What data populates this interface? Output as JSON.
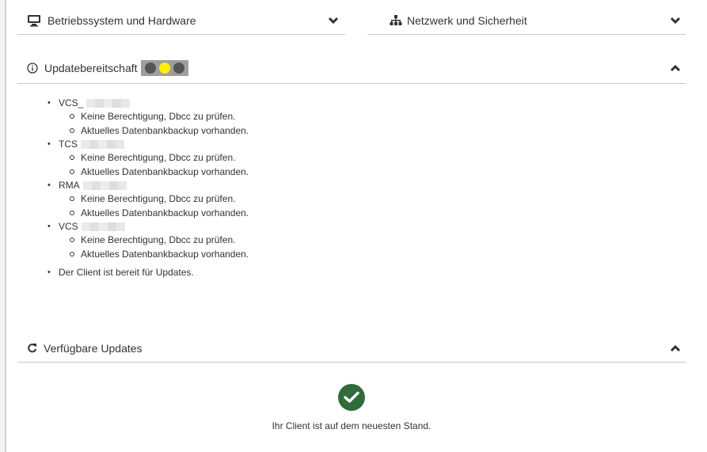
{
  "colors": {
    "accent": "#2f6b3b",
    "light_on": "#ffee00",
    "light_off": "#555555",
    "traffic_bg": "#9e9e9e"
  },
  "sections": {
    "os": {
      "title": "Betriebssystem und Hardware",
      "icon": "monitor-icon",
      "state": "collapsed"
    },
    "network": {
      "title": "Netzwerk und Sicherheit",
      "icon": "sitemap-icon",
      "state": "collapsed"
    },
    "readiness": {
      "title": "Updatebereitschaft",
      "icon": "info-circle-icon",
      "state": "expanded",
      "traffic_light": [
        "off",
        "on",
        "off"
      ]
    },
    "available": {
      "title": "Verfügbare Updates",
      "icon": "refresh-icon",
      "state": "expanded"
    }
  },
  "readiness": {
    "databases": [
      {
        "name": "VCS_",
        "notes": [
          "Keine Berechtigung, Dbcc zu prüfen.",
          "Aktuelles Datenbankbackup vorhanden."
        ]
      },
      {
        "name": "TCS",
        "notes": [
          "Keine Berechtigung, Dbcc zu prüfen.",
          "Aktuelles Datenbankbackup vorhanden."
        ]
      },
      {
        "name": "RMA",
        "notes": [
          "Keine Berechtigung, Dbcc zu prüfen.",
          "Aktuelles Datenbankbackup vorhanden."
        ]
      },
      {
        "name": "VCS",
        "notes": [
          "Keine Berechtigung, Dbcc zu prüfen.",
          "Aktuelles Datenbankbackup vorhanden."
        ]
      }
    ],
    "final": "Der Client ist bereit für Updates."
  },
  "available_updates": {
    "status_icon": "check-circle-icon",
    "message": "Ihr Client ist auf dem neuesten Stand."
  }
}
